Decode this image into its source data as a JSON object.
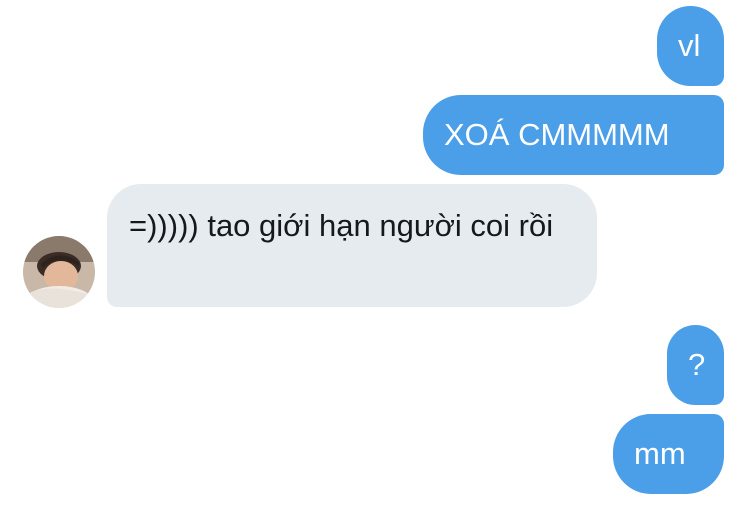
{
  "messages": [
    {
      "direction": "sent",
      "text": "vl"
    },
    {
      "direction": "sent",
      "text": "XOÁ CMMMMM"
    },
    {
      "direction": "received",
      "text": "=))))) tao giới hạn người coi rồi"
    },
    {
      "direction": "sent",
      "text": "?"
    },
    {
      "direction": "sent",
      "text": "mm"
    }
  ],
  "colors": {
    "sent_bubble": "#4b9ee8",
    "received_bubble": "#e6ebf0",
    "sent_text": "#ffffff",
    "received_text": "#15191e"
  },
  "contact": {
    "avatar_icon": "user-avatar-photo"
  }
}
